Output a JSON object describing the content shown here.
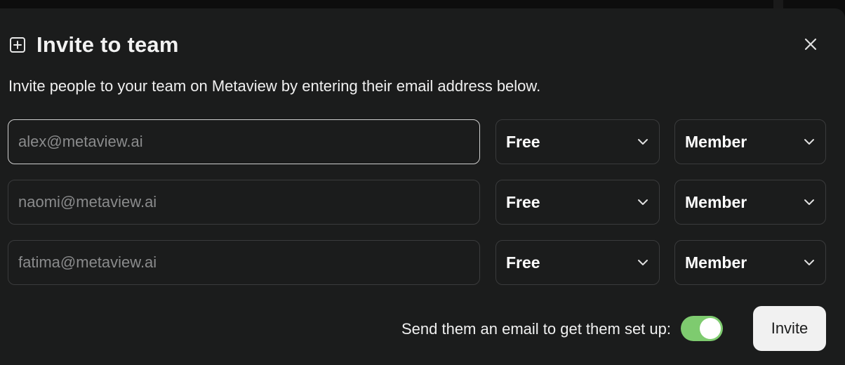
{
  "colors": {
    "toggle_on": "#7ecb6f",
    "modal_bg": "#1b1c1c",
    "text": "#f0f0f0"
  },
  "header": {
    "title": "Invite to team",
    "icon": "plus-square-icon",
    "close_icon": "close-icon"
  },
  "subtitle": "Invite people to your team on Metaview by entering their email address below.",
  "rows": [
    {
      "email_placeholder": "alex@metaview.ai",
      "email_value": "",
      "plan": "Free",
      "role": "Member",
      "focused": true
    },
    {
      "email_placeholder": "naomi@metaview.ai",
      "email_value": "",
      "plan": "Free",
      "role": "Member",
      "focused": false
    },
    {
      "email_placeholder": "fatima@metaview.ai",
      "email_value": "",
      "plan": "Free",
      "role": "Member",
      "focused": false
    }
  ],
  "footer": {
    "toggle_label": "Send them an email to get them set up:",
    "toggle_on": true,
    "invite_label": "Invite"
  }
}
